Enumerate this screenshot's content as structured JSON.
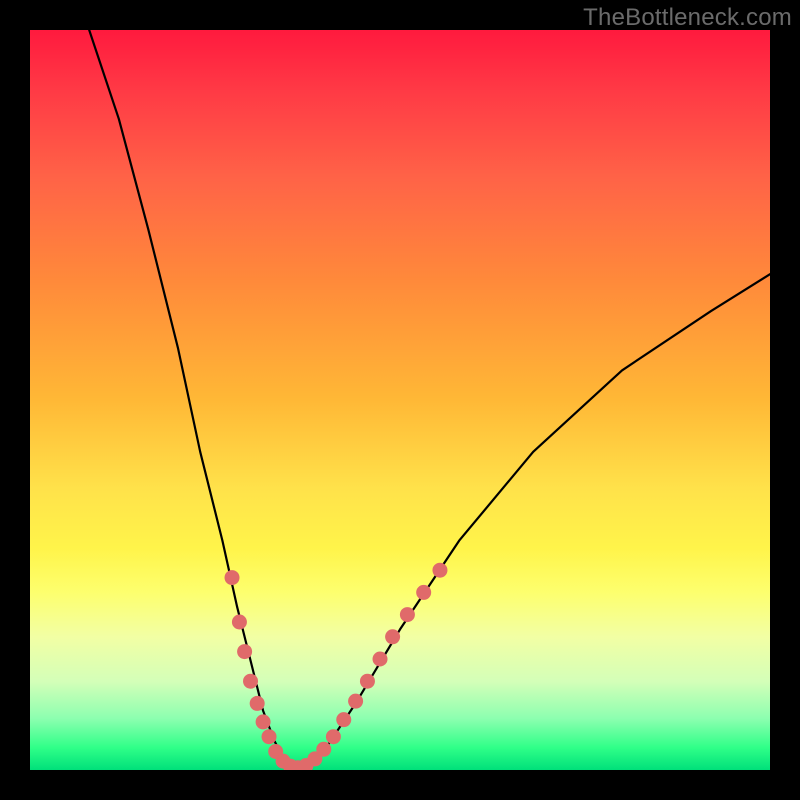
{
  "watermark": "TheBottleneck.com",
  "colors": {
    "curve": "#000000",
    "marker": "#e06a6a",
    "frame": "#000000"
  },
  "chart_data": {
    "type": "line",
    "title": "",
    "xlabel": "",
    "ylabel": "",
    "xlim": [
      0,
      100
    ],
    "ylim": [
      0,
      100
    ],
    "grid": false,
    "legend": false,
    "series": [
      {
        "name": "bottleneck-curve",
        "x": [
          8,
          12,
          16,
          20,
          23,
          26,
          28,
          30,
          31.5,
          33,
          34.5,
          36,
          38,
          40,
          44,
          50,
          58,
          68,
          80,
          92,
          100
        ],
        "y": [
          100,
          88,
          73,
          57,
          43,
          31,
          22,
          14,
          8,
          4,
          1,
          0,
          1,
          3,
          9,
          19,
          31,
          43,
          54,
          62,
          67
        ]
      }
    ],
    "markers": [
      {
        "x": 27.3,
        "y": 26
      },
      {
        "x": 28.3,
        "y": 20
      },
      {
        "x": 29.0,
        "y": 16
      },
      {
        "x": 29.8,
        "y": 12
      },
      {
        "x": 30.7,
        "y": 9
      },
      {
        "x": 31.5,
        "y": 6.5
      },
      {
        "x": 32.3,
        "y": 4.5
      },
      {
        "x": 33.2,
        "y": 2.5
      },
      {
        "x": 34.2,
        "y": 1.2
      },
      {
        "x": 35.2,
        "y": 0.5
      },
      {
        "x": 36.2,
        "y": 0.3
      },
      {
        "x": 37.3,
        "y": 0.6
      },
      {
        "x": 38.5,
        "y": 1.5
      },
      {
        "x": 39.7,
        "y": 2.8
      },
      {
        "x": 41.0,
        "y": 4.5
      },
      {
        "x": 42.4,
        "y": 6.8
      },
      {
        "x": 44.0,
        "y": 9.3
      },
      {
        "x": 45.6,
        "y": 12.0
      },
      {
        "x": 47.3,
        "y": 15.0
      },
      {
        "x": 49.0,
        "y": 18.0
      },
      {
        "x": 51.0,
        "y": 21.0
      },
      {
        "x": 53.2,
        "y": 24.0
      },
      {
        "x": 55.4,
        "y": 27.0
      }
    ]
  }
}
